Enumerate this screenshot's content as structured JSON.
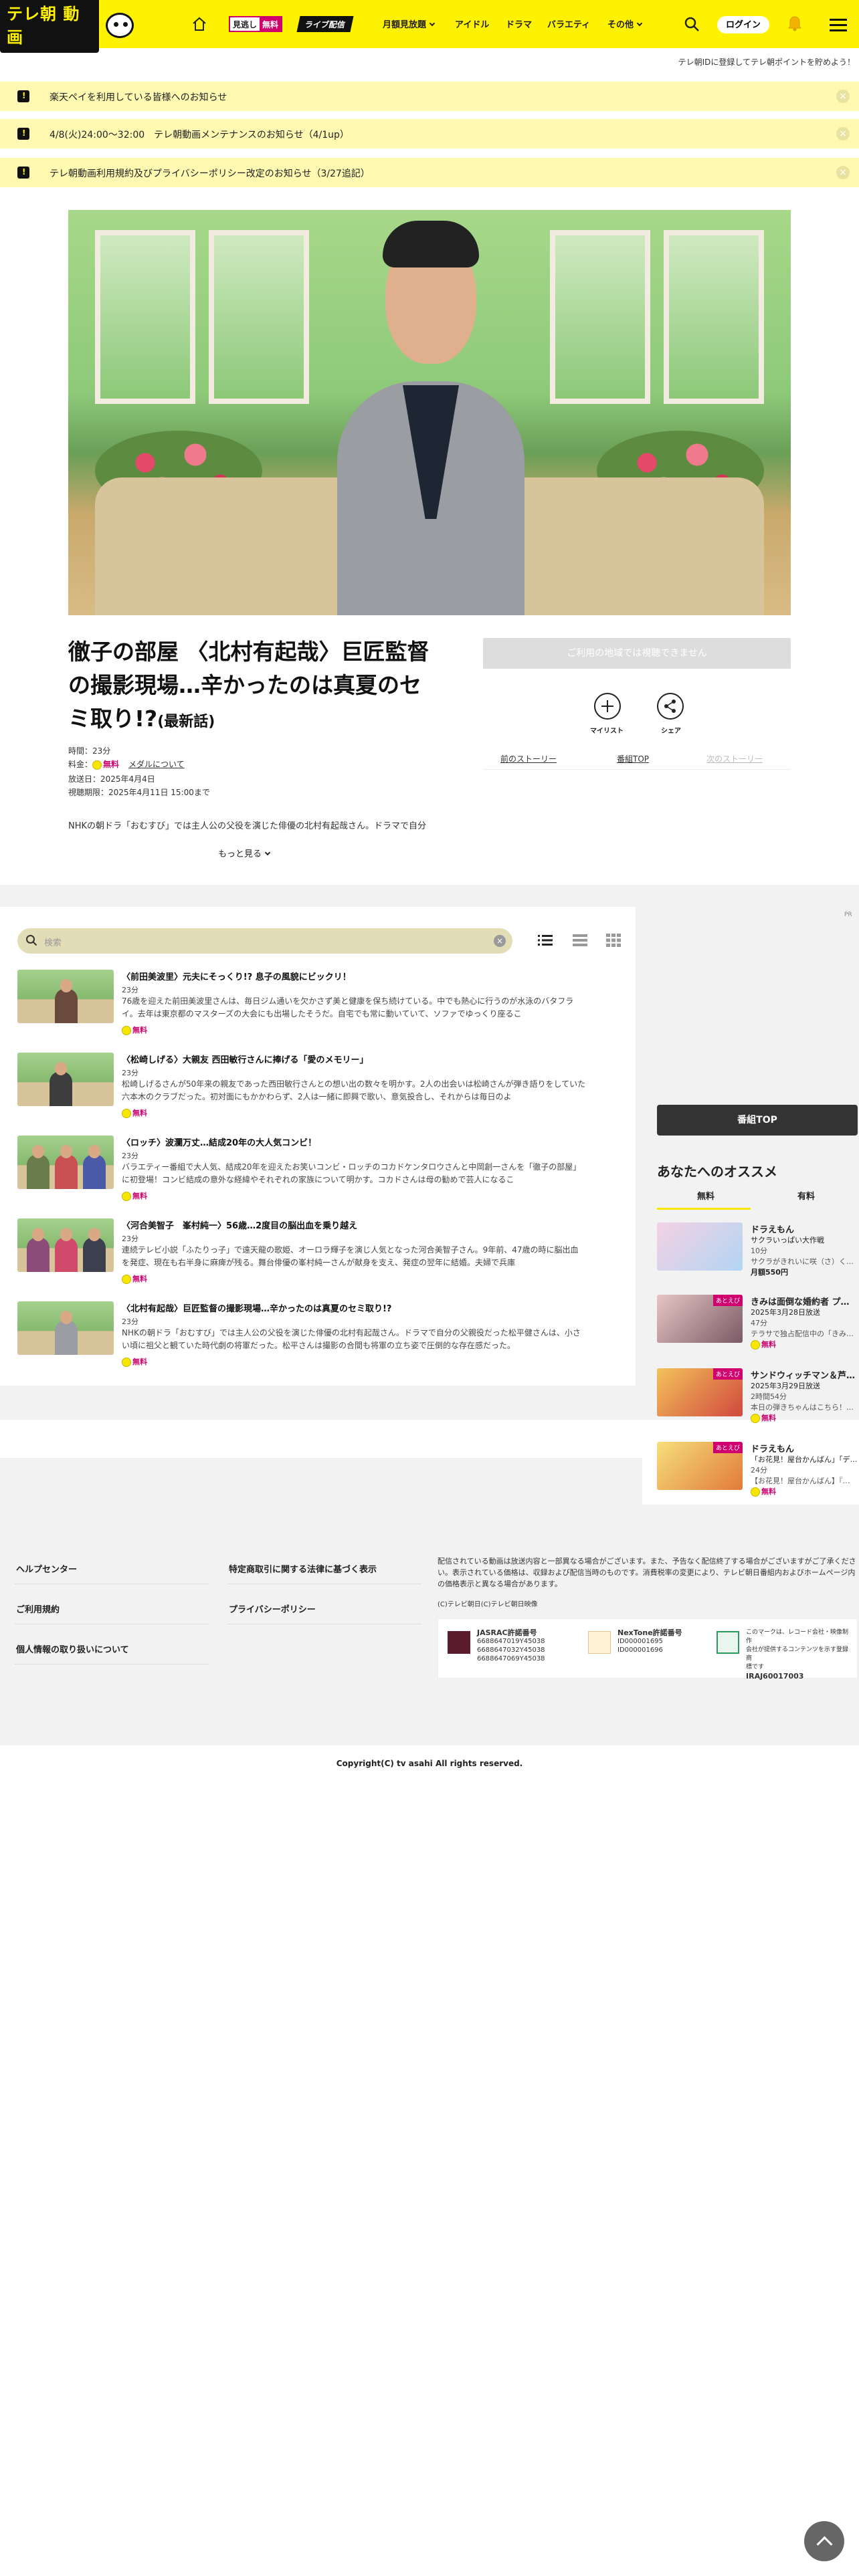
{
  "header": {
    "logo_text": "テレ朝 動画",
    "mitsu_label": "見逃し",
    "mitsu_free": "無料",
    "live_label": "ライブ配信",
    "nav": [
      "月額見放題",
      "アイドル",
      "ドラマ",
      "バラエティ",
      "その他"
    ],
    "login": "ログイン"
  },
  "promo_line": "テレ朝IDに登録してテレ朝ポイントを貯めよう！",
  "notices": [
    "楽天ペイを利用している皆様へのお知らせ",
    "4/8(火)24:00～32:00　テレ朝動画メンテナンスのお知らせ（4/1up）",
    "テレ朝動画利用規約及びプライバシーポリシー改定のお知らせ（3/27追記）"
  ],
  "episode": {
    "title": "徹子の部屋 〈北村有起哉〉巨匠監督の撮影現場…辛かったのは真夏のセミ取り!?",
    "latest": "(最新話)",
    "duration": "時間：23分",
    "price_label": "料金：",
    "price_free": "無料",
    "media_link": "メダルについて",
    "aired": "放送日：2025年4月4日",
    "deadline": "視聴期限：2025年4月11日 15:00まで",
    "description": "NHKの朝ドラ「おむすび」では主人公の父役を演じた俳優の北村有起哉さん。ドラマで自分",
    "more": "もっと見る"
  },
  "actions": {
    "unavailable": "ご利用の地域では視聴できません",
    "mylist": "マイリスト",
    "share": "シェア",
    "prev": "前のストーリー",
    "top": "番組TOP",
    "next": "次のストーリー"
  },
  "list": {
    "search_placeholder": "検索",
    "episodes": [
      {
        "title": "〈前田美波里〉元夫にそっくり!? 息子の風貌にビックリ！",
        "duration": "23分",
        "desc": "76歳を迎えた前田美波里さんは、毎日ジム通いを欠かさず美と健康を保ち続けている。中でも熱心に行うのが水泳のバタフライ。去年は東京都のマスターズの大会にも出場したそうだ。自宅でも常に動いていて、ソファでゆっくり座るこ",
        "free": "無料"
      },
      {
        "title": "〈松崎しげる〉大親友 西田敏行さんに捧げる「愛のメモリー」",
        "duration": "23分",
        "desc": "松崎しげるさんが50年来の親友であった西田敏行さんとの想い出の数々を明かす。2人の出会いは松崎さんが弾き語りをしていた六本木のクラブだった。初対面にもかかわらず、2人は一緒に即興で歌い、意気投合し、それからは毎日のよ",
        "free": "無料"
      },
      {
        "title": "〈ロッチ〉波瀾万丈…結成20年の大人気コンビ！",
        "duration": "23分",
        "desc": "バラエティー番組で大人気、結成20年を迎えたお笑いコンビ・ロッチのコカドケンタロウさんと中岡創一さんを「徹子の部屋」に初登場！コンビ結成の意外な経緯やそれぞれの家族について明かす。コカドさんは母の勧めで芸人になるこ",
        "free": "無料"
      },
      {
        "title": "〈河合美智子　峯村純一〉56歳…2度目の脳出血を乗り越え",
        "duration": "23分",
        "desc": "連続テレビ小説「ふたりっ子」で遠天龍の歌姫、オーロラ輝子を演じ人気となった河合美智子さん。9年前、47歳の時に脳出血を発症、現在も右半身に麻痺が残る。舞台俳優の峯村純一さんが献身を支え、発症の翌年に結婚。夫婦で兵庫",
        "free": "無料"
      },
      {
        "title": "〈北村有起哉〉巨匠監督の撮影現場…辛かったのは真夏のセミ取り!?",
        "duration": "23分",
        "desc": "NHKの朝ドラ「おむすび」では主人公の父役を演じた俳優の北村有起哉さん。ドラマで自分の父親役だった松平健さんは、小さい頃に祖父と観ていた時代劇の将軍だった。松平さんは撮影の合間も将軍の立ち姿で圧倒的な存在感だった。",
        "free": "無料"
      }
    ]
  },
  "sidebar": {
    "pr": "PR",
    "program_top": "番組TOP",
    "rec_title": "あなたへのオススメ",
    "tabs": [
      "無料",
      "有料"
    ],
    "items": [
      {
        "name": "ドラえもん",
        "sub": "サクラいっぱい大作戦",
        "l3": "10分",
        "l4": "サクラがきれいに咲（さ）く…",
        "price": "月額550円",
        "tag": ""
      },
      {
        "name": "きみは面倒な婚約者 プ…",
        "sub": "2025年3月28日放送",
        "l3": "47分",
        "l4": "テラサで独占配信中の「きみ…",
        "price": "無料",
        "tag": "あとえび"
      },
      {
        "name": "サンドウィッチマン＆芦…",
        "sub": "2025年3月29日放送",
        "l3": "2時間54分",
        "l4": "本日の弾きちゃんはこちら！…",
        "price": "無料",
        "tag": "あとえび"
      },
      {
        "name": "ドラえもん",
        "sub": "「お花見！屋台かんばん」「デ…",
        "l3": "24分",
        "l4": "【お花見！屋台かんばん】『…",
        "price": "無料",
        "tag": "あとえび"
      }
    ]
  },
  "footer": {
    "links_left": [
      "ヘルプセンター",
      "ご利用規約",
      "個人情報の取り扱いについて"
    ],
    "links_right": [
      "特定商取引に関する法律に基づく表示",
      "プライバシーポリシー"
    ],
    "notice": "配信されている動画は放送内容と一部異なる場合がございます。また、予告なく配信終了する場合がございますがご了承ください。表示されている価格は、収録および配信当時のものです。消費税率の変更により、テレビ朝日番組内およびホームページ内の価格表示と異なる場合があります。",
    "small": "(C)テレビ朝日(C)テレビ朝日映像",
    "licenses": [
      {
        "title": "JASRAC許諾番号",
        "lines": [
          "6688647019Y45038",
          "6688647032Y45038",
          "6688647069Y45038"
        ]
      },
      {
        "title": "NexTone許諾番号",
        "lines": [
          "ID000001695",
          "ID000001696"
        ]
      },
      {
        "title": "エルマーク",
        "lines": [
          "このマークは、レコード会社・映像制作",
          "会社が提供するコンテンツを示す登録商",
          "標です",
          "IRAJ60017003"
        ]
      }
    ],
    "copyright": "Copyright(C) tv asahi All rights reserved."
  }
}
